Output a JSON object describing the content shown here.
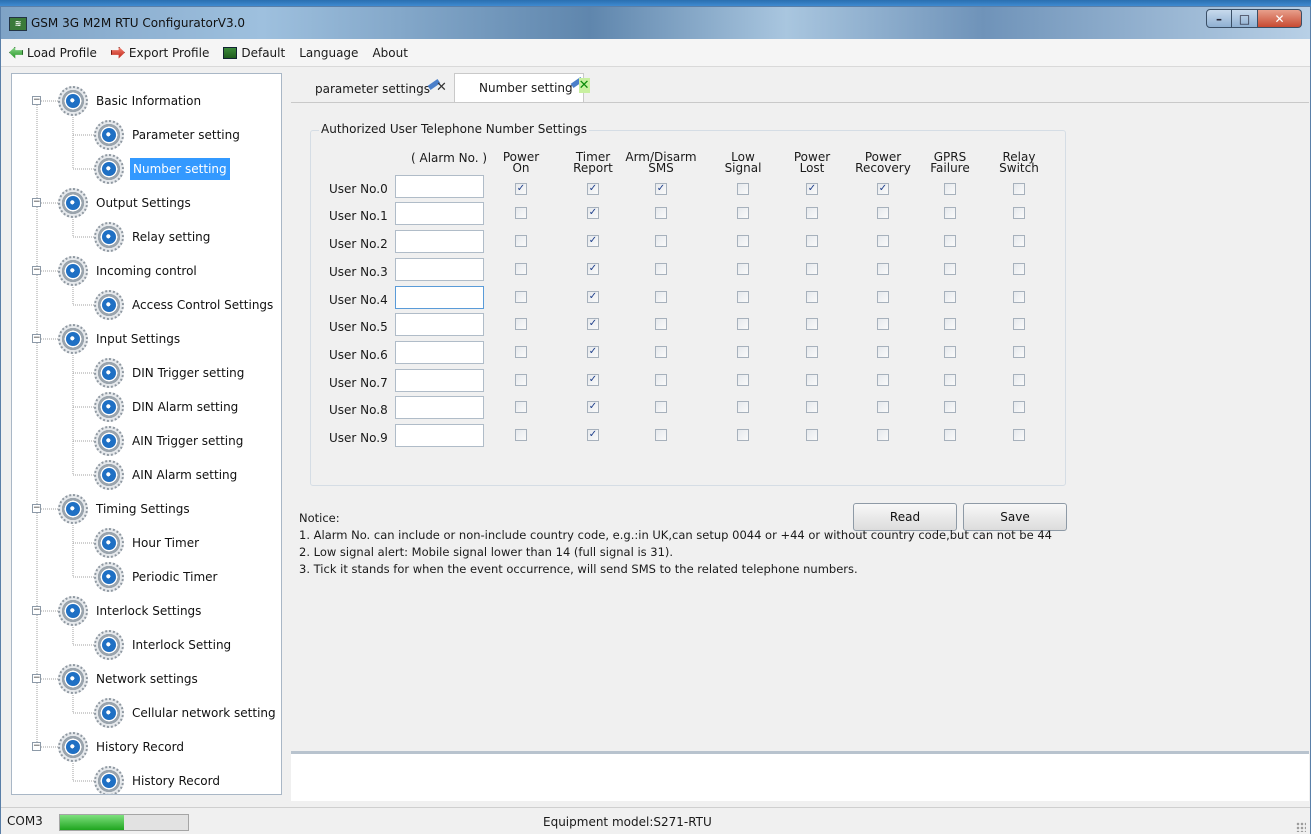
{
  "window": {
    "title": "GSM 3G M2M RTU ConfiguratorV3.0",
    "app_icon": "app-logo-icon"
  },
  "menu": {
    "load_profile": "Load Profile",
    "export_profile": "Export Profile",
    "default": "Default",
    "language": "Language",
    "about": "About"
  },
  "tree": {
    "groups": [
      {
        "label": "Basic Information",
        "children": [
          "Parameter setting",
          "Number setting"
        ]
      },
      {
        "label": "Output Settings",
        "children": [
          "Relay setting"
        ]
      },
      {
        "label": "Incoming control",
        "children": [
          "Access Control Settings"
        ]
      },
      {
        "label": "Input Settings",
        "children": [
          "DIN Trigger setting",
          "DIN Alarm setting",
          "AIN Trigger setting",
          "AIN Alarm setting"
        ]
      },
      {
        "label": "Timing Settings",
        "children": [
          "Hour Timer",
          "Periodic Timer"
        ]
      },
      {
        "label": "Interlock Settings",
        "children": [
          "Interlock Setting"
        ]
      },
      {
        "label": "Network settings",
        "children": [
          "Cellular network setting"
        ]
      },
      {
        "label": "History Record",
        "children": [
          "History Record"
        ]
      }
    ],
    "selected": "Number setting"
  },
  "tabs": [
    {
      "label": "parameter settings",
      "active": false
    },
    {
      "label": "Number setting",
      "active": true
    }
  ],
  "group_title": "Authorized User Telephone Number Settings",
  "alarm_header": "( Alarm No. )",
  "columns": [
    [
      "Power",
      "On"
    ],
    [
      "Timer",
      "Report"
    ],
    [
      "Arm/Disarm",
      "SMS"
    ],
    [
      "Low",
      "Signal"
    ],
    [
      "Power",
      "Lost"
    ],
    [
      "Power",
      "Recovery"
    ],
    [
      "GPRS",
      "Failure"
    ],
    [
      "Relay",
      "Switch"
    ]
  ],
  "users": [
    {
      "label": "User No.0",
      "number": "",
      "checks": [
        true,
        true,
        true,
        false,
        true,
        true,
        false,
        false
      ]
    },
    {
      "label": "User No.1",
      "number": "",
      "checks": [
        false,
        true,
        false,
        false,
        false,
        false,
        false,
        false
      ]
    },
    {
      "label": "User No.2",
      "number": "",
      "checks": [
        false,
        true,
        false,
        false,
        false,
        false,
        false,
        false
      ]
    },
    {
      "label": "User No.3",
      "number": "",
      "checks": [
        false,
        true,
        false,
        false,
        false,
        false,
        false,
        false
      ]
    },
    {
      "label": "User No.4",
      "number": "",
      "checks": [
        false,
        true,
        false,
        false,
        false,
        false,
        false,
        false
      ]
    },
    {
      "label": "User No.5",
      "number": "",
      "checks": [
        false,
        true,
        false,
        false,
        false,
        false,
        false,
        false
      ]
    },
    {
      "label": "User No.6",
      "number": "",
      "checks": [
        false,
        true,
        false,
        false,
        false,
        false,
        false,
        false
      ]
    },
    {
      "label": "User No.7",
      "number": "",
      "checks": [
        false,
        true,
        false,
        false,
        false,
        false,
        false,
        false
      ]
    },
    {
      "label": "User No.8",
      "number": "",
      "checks": [
        false,
        true,
        false,
        false,
        false,
        false,
        false,
        false
      ]
    },
    {
      "label": "User No.9",
      "number": "",
      "checks": [
        false,
        true,
        false,
        false,
        false,
        false,
        false,
        false
      ]
    }
  ],
  "buttons": {
    "read": "Read",
    "save": "Save"
  },
  "notice": {
    "title": "Notice:",
    "lines": [
      "1. Alarm No. can include or non-include country code, e.g.:in UK,can setup 0044 or +44 or without country code,but can not be 44",
      "2. Low signal alert: Mobile signal lower than 14 (full signal is 31).",
      "3. Tick it stands for when the event occurrence, will send SMS to the related telephone numbers."
    ]
  },
  "status": {
    "port": "COM3",
    "progress_fraction": 0.5,
    "model": "Equipment model:S271-RTU"
  },
  "colors": {
    "selection": "#3399ff",
    "progress": "#1fa51f"
  }
}
